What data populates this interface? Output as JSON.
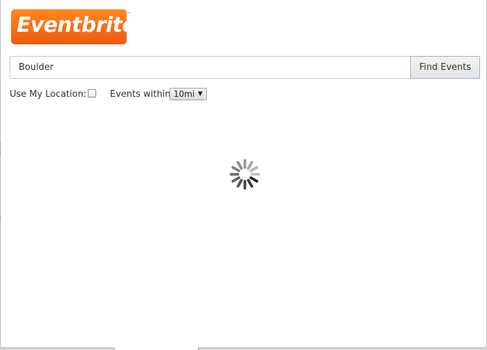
{
  "logo": {
    "text": "Eventbrite",
    "tm": "™"
  },
  "search": {
    "value": "Boulder",
    "button_label": "Find Events"
  },
  "options": {
    "use_location_label": "Use My Location:",
    "use_location_checked": false,
    "within_label": "Events within",
    "within_value": "10mi"
  },
  "status": {
    "loading": true
  },
  "colors": {
    "brand": "#f05a12",
    "button_border": "#9ab0d0"
  },
  "icons": [
    "loading-spinner-icon",
    "chevron-down-icon"
  ]
}
